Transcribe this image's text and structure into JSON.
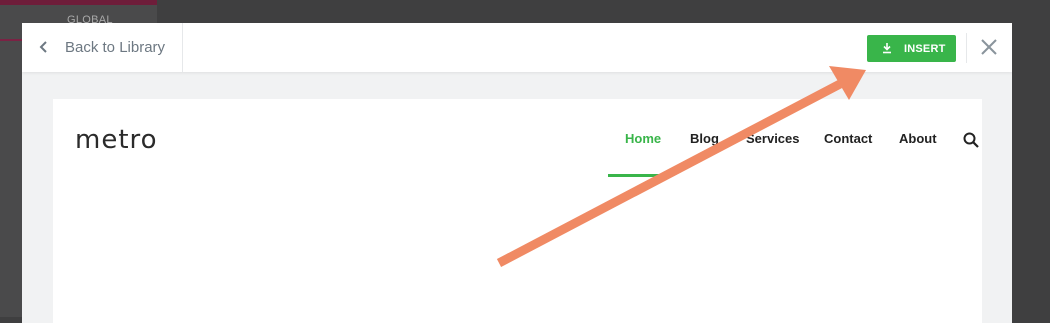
{
  "background_editor": {
    "tab_label": "GLOBAL"
  },
  "modal": {
    "back_label": "Back to Library",
    "insert_label": "INSERT",
    "back_icon": "chevron-left-icon",
    "insert_icon": "download-icon",
    "close_icon": "close-icon"
  },
  "preview": {
    "logo": "metro",
    "nav": [
      {
        "label": "Home",
        "active": true
      },
      {
        "label": "Blog",
        "active": false
      },
      {
        "label": "Services",
        "active": false
      },
      {
        "label": "Contact",
        "active": false
      },
      {
        "label": "About",
        "active": false
      }
    ],
    "search_icon": "search-icon"
  },
  "colors": {
    "accent": "#39b54a",
    "annotation_arrow": "#f08a64",
    "overlay": "#3f3f40"
  }
}
